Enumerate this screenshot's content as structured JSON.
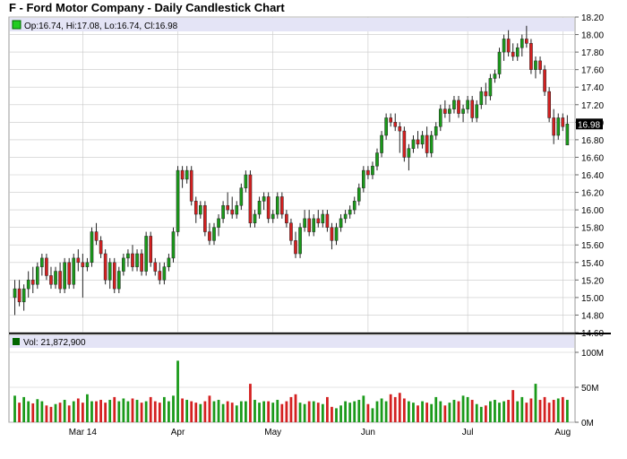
{
  "title": "F - Ford Motor Company - Daily Candlestick Chart",
  "colors": {
    "up": "#1a9a1a",
    "down": "#d42020",
    "neutral": "#1a1a99",
    "legend_bg": "#e4e4f6",
    "grid": "#c8c8c8",
    "last_price_bg": "#000000"
  },
  "chart_data": [
    {
      "type": "candlestick",
      "title": "",
      "legend": "Op:16.74, Hi:17.08, Lo:16.74, Cl:16.98",
      "ylim": [
        14.6,
        18.2
      ],
      "yticks": [
        "18.20",
        "18.00",
        "17.80",
        "17.60",
        "17.40",
        "17.20",
        "17.00",
        "16.80",
        "16.60",
        "16.40",
        "16.20",
        "16.00",
        "15.80",
        "15.60",
        "15.40",
        "15.20",
        "15.00",
        "14.80",
        "14.60"
      ],
      "last_price_label": "16.98",
      "x_tick_labels": [
        {
          "label": "Mar 14",
          "index": 15
        },
        {
          "label": "Apr",
          "index": 36
        },
        {
          "label": "May",
          "index": 57
        },
        {
          "label": "Jun",
          "index": 78
        },
        {
          "label": "Jul",
          "index": 100
        },
        {
          "label": "Aug",
          "index": 121
        }
      ],
      "candles": [
        [
          15.0,
          15.2,
          14.8,
          15.1
        ],
        [
          15.1,
          15.2,
          14.9,
          14.95
        ],
        [
          14.95,
          15.15,
          14.85,
          15.1
        ],
        [
          15.1,
          15.3,
          15.0,
          15.2
        ],
        [
          15.2,
          15.35,
          15.05,
          15.15
        ],
        [
          15.15,
          15.4,
          15.1,
          15.35
        ],
        [
          15.35,
          15.5,
          15.25,
          15.45
        ],
        [
          15.45,
          15.5,
          15.2,
          15.25
        ],
        [
          15.25,
          15.35,
          15.1,
          15.15
        ],
        [
          15.15,
          15.35,
          15.1,
          15.3
        ],
        [
          15.3,
          15.4,
          15.05,
          15.1
        ],
        [
          15.1,
          15.45,
          15.05,
          15.4
        ],
        [
          15.4,
          15.45,
          15.1,
          15.15
        ],
        [
          15.15,
          15.5,
          15.1,
          15.45
        ],
        [
          15.45,
          15.55,
          15.3,
          15.4
        ],
        [
          15.4,
          15.5,
          15.0,
          15.35
        ],
        [
          15.35,
          15.45,
          15.3,
          15.4
        ],
        [
          15.4,
          15.8,
          15.35,
          15.75
        ],
        [
          15.75,
          15.85,
          15.6,
          15.65
        ],
        [
          15.65,
          15.7,
          15.45,
          15.5
        ],
        [
          15.5,
          15.55,
          15.15,
          15.2
        ],
        [
          15.2,
          15.45,
          15.1,
          15.4
        ],
        [
          15.4,
          15.45,
          15.05,
          15.1
        ],
        [
          15.1,
          15.35,
          15.05,
          15.3
        ],
        [
          15.3,
          15.5,
          15.25,
          15.45
        ],
        [
          15.45,
          15.55,
          15.35,
          15.5
        ],
        [
          15.5,
          15.6,
          15.3,
          15.35
        ],
        [
          15.35,
          15.55,
          15.3,
          15.5
        ],
        [
          15.5,
          15.55,
          15.25,
          15.3
        ],
        [
          15.3,
          15.75,
          15.25,
          15.7
        ],
        [
          15.7,
          15.75,
          15.35,
          15.4
        ],
        [
          15.4,
          15.45,
          15.25,
          15.3
        ],
        [
          15.3,
          15.4,
          15.15,
          15.2
        ],
        [
          15.2,
          15.4,
          15.15,
          15.35
        ],
        [
          15.35,
          15.5,
          15.3,
          15.45
        ],
        [
          15.45,
          15.8,
          15.4,
          15.75
        ],
        [
          15.75,
          16.5,
          15.7,
          16.45
        ],
        [
          16.45,
          16.5,
          16.25,
          16.35
        ],
        [
          16.35,
          16.5,
          16.3,
          16.45
        ],
        [
          16.45,
          16.5,
          16.05,
          16.1
        ],
        [
          16.1,
          16.15,
          15.85,
          15.95
        ],
        [
          15.95,
          16.1,
          15.9,
          16.05
        ],
        [
          16.05,
          16.1,
          15.7,
          15.75
        ],
        [
          15.75,
          15.85,
          15.6,
          15.65
        ],
        [
          15.65,
          15.85,
          15.6,
          15.8
        ],
        [
          15.8,
          15.95,
          15.7,
          15.9
        ],
        [
          15.9,
          16.1,
          15.85,
          16.05
        ],
        [
          16.05,
          16.2,
          15.95,
          16.0
        ],
        [
          16.0,
          16.15,
          15.9,
          15.95
        ],
        [
          15.95,
          16.1,
          15.9,
          16.05
        ],
        [
          16.05,
          16.3,
          16.0,
          16.25
        ],
        [
          16.25,
          16.45,
          16.2,
          16.4
        ],
        [
          16.4,
          16.45,
          15.8,
          15.85
        ],
        [
          15.85,
          16.0,
          15.8,
          15.95
        ],
        [
          15.95,
          16.15,
          15.9,
          16.1
        ],
        [
          16.1,
          16.2,
          16.0,
          16.15
        ],
        [
          16.15,
          16.2,
          15.85,
          15.9
        ],
        [
          15.9,
          16.0,
          15.85,
          15.95
        ],
        [
          15.95,
          16.2,
          15.9,
          16.15
        ],
        [
          16.15,
          16.2,
          15.9,
          15.95
        ],
        [
          15.95,
          16.0,
          15.8,
          15.85
        ],
        [
          15.85,
          15.9,
          15.6,
          15.65
        ],
        [
          15.65,
          15.75,
          15.45,
          15.5
        ],
        [
          15.5,
          15.85,
          15.45,
          15.8
        ],
        [
          15.8,
          16.0,
          15.75,
          15.9
        ],
        [
          15.9,
          16.0,
          15.7,
          15.75
        ],
        [
          15.75,
          15.95,
          15.7,
          15.9
        ],
        [
          15.9,
          16.0,
          15.8,
          15.85
        ],
        [
          15.85,
          16.0,
          15.8,
          15.95
        ],
        [
          15.95,
          16.0,
          15.75,
          15.8
        ],
        [
          15.8,
          15.85,
          15.55,
          15.65
        ],
        [
          15.65,
          15.85,
          15.6,
          15.8
        ],
        [
          15.8,
          15.95,
          15.75,
          15.9
        ],
        [
          15.9,
          16.0,
          15.85,
          15.95
        ],
        [
          15.95,
          16.05,
          15.9,
          16.0
        ],
        [
          16.0,
          16.15,
          15.95,
          16.1
        ],
        [
          16.1,
          16.3,
          16.05,
          16.25
        ],
        [
          16.25,
          16.5,
          16.2,
          16.45
        ],
        [
          16.45,
          16.5,
          16.35,
          16.4
        ],
        [
          16.4,
          16.55,
          16.35,
          16.5
        ],
        [
          16.5,
          16.7,
          16.45,
          16.65
        ],
        [
          16.65,
          16.9,
          16.6,
          16.85
        ],
        [
          16.85,
          17.1,
          16.8,
          17.05
        ],
        [
          17.05,
          17.1,
          16.95,
          17.0
        ],
        [
          17.0,
          17.1,
          16.9,
          16.95
        ],
        [
          16.95,
          17.0,
          16.65,
          16.9
        ],
        [
          16.9,
          16.95,
          16.55,
          16.6
        ],
        [
          16.6,
          16.75,
          16.45,
          16.7
        ],
        [
          16.7,
          16.85,
          16.65,
          16.8
        ],
        [
          16.8,
          16.9,
          16.7,
          16.75
        ],
        [
          16.75,
          16.9,
          16.7,
          16.85
        ],
        [
          16.85,
          16.95,
          16.6,
          16.65
        ],
        [
          16.65,
          16.9,
          16.6,
          16.85
        ],
        [
          16.85,
          17.0,
          16.8,
          16.95
        ],
        [
          16.95,
          17.2,
          16.9,
          17.15
        ],
        [
          17.15,
          17.25,
          17.05,
          17.1
        ],
        [
          17.1,
          17.2,
          17.0,
          17.15
        ],
        [
          17.15,
          17.3,
          17.1,
          17.25
        ],
        [
          17.25,
          17.3,
          17.05,
          17.1
        ],
        [
          17.1,
          17.2,
          17.0,
          17.15
        ],
        [
          17.15,
          17.3,
          17.1,
          17.25
        ],
        [
          17.25,
          17.3,
          17.0,
          17.05
        ],
        [
          17.05,
          17.25,
          17.0,
          17.2
        ],
        [
          17.2,
          17.4,
          17.15,
          17.35
        ],
        [
          17.35,
          17.45,
          17.2,
          17.3
        ],
        [
          17.3,
          17.55,
          17.25,
          17.5
        ],
        [
          17.5,
          17.6,
          17.45,
          17.55
        ],
        [
          17.55,
          17.85,
          17.5,
          17.8
        ],
        [
          17.8,
          18.0,
          17.7,
          17.95
        ],
        [
          17.95,
          18.05,
          17.75,
          17.8
        ],
        [
          17.8,
          17.9,
          17.7,
          17.75
        ],
        [
          17.75,
          17.9,
          17.7,
          17.85
        ],
        [
          17.85,
          18.0,
          17.75,
          17.95
        ],
        [
          17.95,
          18.1,
          17.85,
          17.9
        ],
        [
          17.9,
          17.95,
          17.55,
          17.6
        ],
        [
          17.6,
          17.75,
          17.5,
          17.7
        ],
        [
          17.7,
          17.75,
          17.55,
          17.6
        ],
        [
          17.6,
          17.65,
          17.3,
          17.35
        ],
        [
          17.35,
          17.4,
          17.0,
          17.05
        ],
        [
          17.05,
          17.15,
          16.75,
          16.85
        ],
        [
          16.85,
          17.1,
          16.8,
          17.05
        ],
        [
          17.05,
          17.1,
          16.9,
          16.95
        ],
        [
          16.74,
          17.08,
          16.74,
          16.98
        ]
      ],
      "volume": {
        "legend": "Vol: 21,872,900",
        "yticks": [
          "100M",
          "50M",
          "0M"
        ],
        "ylim": [
          0,
          100
        ],
        "values": [
          38,
          28,
          36,
          30,
          27,
          33,
          30,
          24,
          22,
          26,
          28,
          32,
          24,
          30,
          34,
          28,
          40,
          30,
          30,
          32,
          28,
          32,
          36,
          30,
          34,
          30,
          34,
          32,
          28,
          30,
          36,
          30,
          28,
          36,
          30,
          38,
          88,
          34,
          32,
          30,
          28,
          26,
          30,
          38,
          30,
          32,
          26,
          30,
          28,
          24,
          30,
          30,
          55,
          32,
          28,
          30,
          30,
          28,
          32,
          26,
          30,
          36,
          40,
          28,
          26,
          30,
          30,
          28,
          26,
          36,
          22,
          20,
          24,
          30,
          28,
          30,
          32,
          38,
          26,
          20,
          30,
          34,
          30,
          40,
          36,
          42,
          34,
          30,
          28,
          24,
          30,
          28,
          26,
          36,
          30,
          24,
          28,
          32,
          30,
          38,
          36,
          32,
          26,
          22,
          24,
          30,
          32,
          28,
          30,
          32,
          46,
          30,
          36,
          28,
          34,
          55,
          32,
          36,
          28,
          32,
          34,
          36,
          32,
          28,
          30,
          24,
          22
        ]
      }
    }
  ]
}
